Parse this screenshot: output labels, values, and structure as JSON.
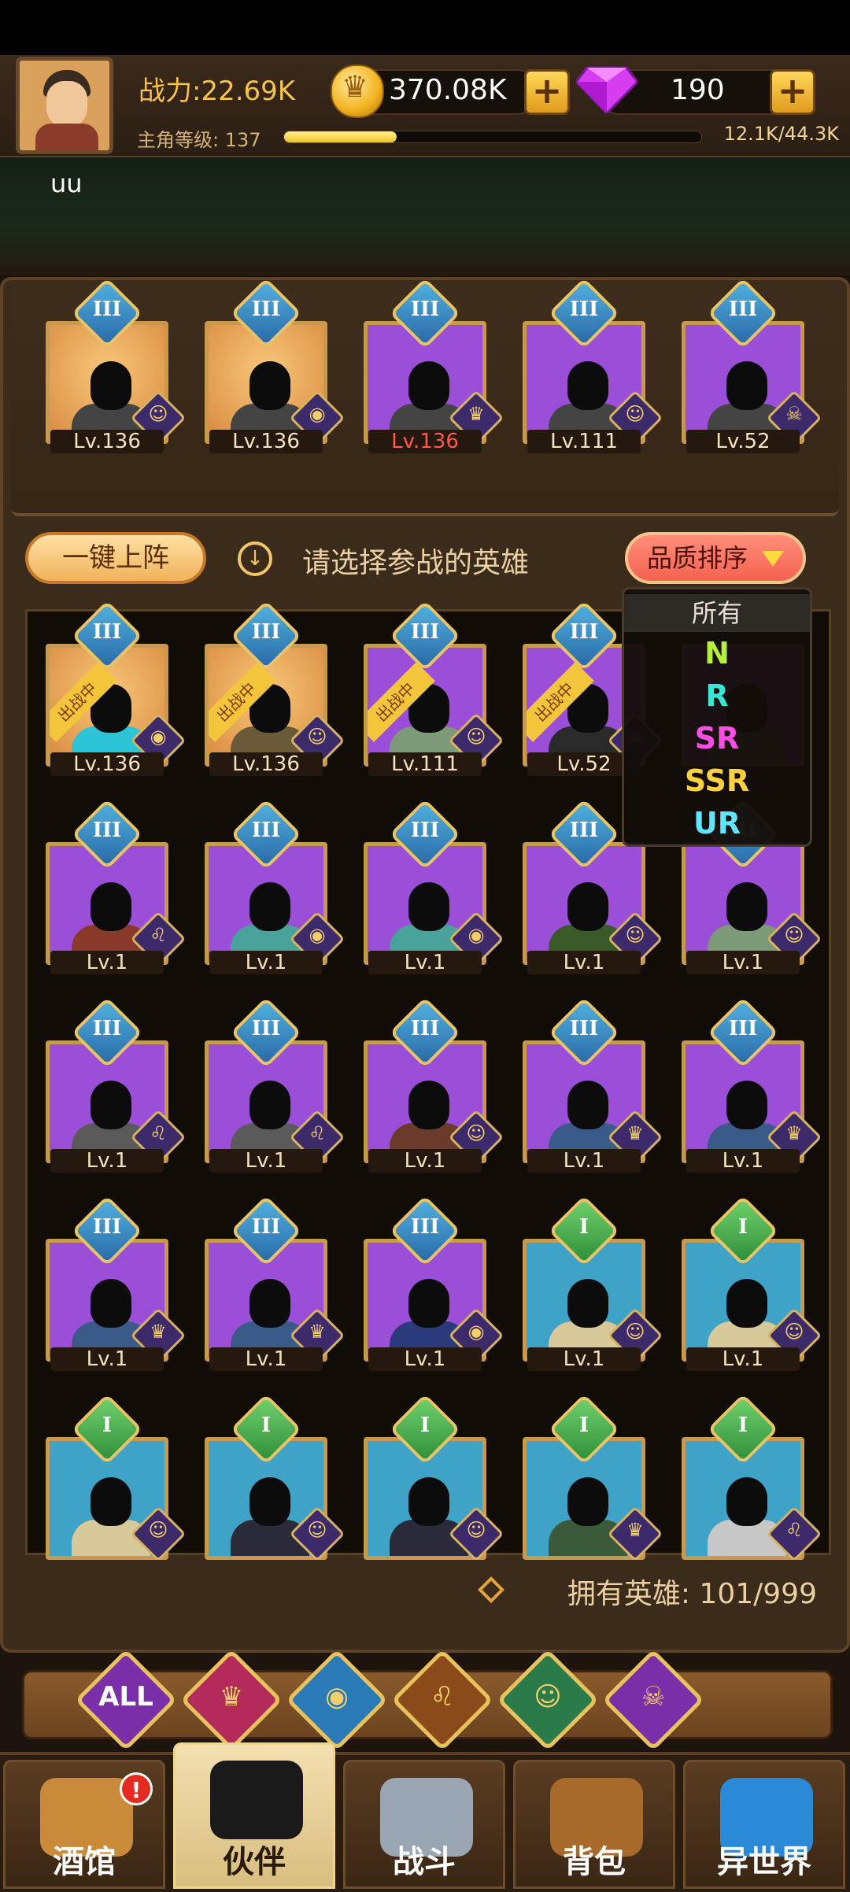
{
  "header": {
    "power_text": "战力:22.69K",
    "level_label": "主角等级: 137",
    "exp_text": "12.1K/44.3K",
    "exp_progress": 0.27,
    "gold": "370.08K",
    "gems": "190",
    "plus": "+",
    "username": "uu"
  },
  "team": [
    {
      "level": "Lv.136",
      "rank": "III",
      "bg": "gold",
      "class_glyph": "☺",
      "red": false
    },
    {
      "level": "Lv.136",
      "rank": "III",
      "bg": "gold",
      "class_glyph": "◉",
      "red": false
    },
    {
      "level": "Lv.136",
      "rank": "III",
      "bg": "purple",
      "class_glyph": "♛",
      "red": true
    },
    {
      "level": "Lv.111",
      "rank": "III",
      "bg": "purple",
      "class_glyph": "☺",
      "red": false
    },
    {
      "level": "Lv.52",
      "rank": "III",
      "bg": "purple",
      "class_glyph": "☠",
      "red": false
    }
  ],
  "actions": {
    "oneclick_label": "一键上阵",
    "hint_text": "请选择参战的英雄",
    "sort_label": "品质排序",
    "info_glyph": "↓"
  },
  "dropdown": {
    "items": [
      {
        "label": "所有",
        "color": "#e8e0d6"
      },
      {
        "label": "N",
        "color": "#b6f03a"
      },
      {
        "label": "R",
        "color": "#37e7d6"
      },
      {
        "label": "SR",
        "color": "#ff4ee8"
      },
      {
        "label": "SSR",
        "color": "#ffd23a"
      },
      {
        "label": "UR",
        "color": "#5fe6ff"
      }
    ]
  },
  "deployed_label": "出战中",
  "heroes": [
    {
      "level": "Lv.136",
      "rank": "III",
      "bg": "gold",
      "deployed": true,
      "class_glyph": "◉",
      "color": "#2ec4d8"
    },
    {
      "level": "Lv.136",
      "rank": "III",
      "bg": "gold",
      "deployed": true,
      "class_glyph": "☺",
      "color": "#6b5a3a"
    },
    {
      "level": "Lv.111",
      "rank": "III",
      "bg": "purple",
      "deployed": true,
      "class_glyph": "☺",
      "color": "#7d9a78"
    },
    {
      "level": "Lv.52",
      "rank": "III",
      "bg": "purple",
      "deployed": true,
      "class_glyph": "☠",
      "color": "#2a2a2a"
    },
    {
      "level": "",
      "rank": "",
      "bg": "purple",
      "deployed": false,
      "class_glyph": "",
      "color": "#7d9a78"
    },
    {
      "level": "Lv.1",
      "rank": "III",
      "bg": "purple",
      "deployed": false,
      "class_glyph": "♌",
      "color": "#8a3a2a"
    },
    {
      "level": "Lv.1",
      "rank": "III",
      "bg": "purple",
      "deployed": false,
      "class_glyph": "◉",
      "color": "#4aa39a"
    },
    {
      "level": "Lv.1",
      "rank": "III",
      "bg": "purple",
      "deployed": false,
      "class_glyph": "◉",
      "color": "#4aa39a"
    },
    {
      "level": "Lv.1",
      "rank": "III",
      "bg": "purple",
      "deployed": false,
      "class_glyph": "☺",
      "color": "#3a5a2a"
    },
    {
      "level": "Lv.1",
      "rank": "III",
      "bg": "purple",
      "deployed": false,
      "class_glyph": "☺",
      "color": "#7d9a78"
    },
    {
      "level": "Lv.1",
      "rank": "III",
      "bg": "purple",
      "deployed": false,
      "class_glyph": "♌",
      "color": "#5a5a5a"
    },
    {
      "level": "Lv.1",
      "rank": "III",
      "bg": "purple",
      "deployed": false,
      "class_glyph": "♌",
      "color": "#5a5a5a"
    },
    {
      "level": "Lv.1",
      "rank": "III",
      "bg": "purple",
      "deployed": false,
      "class_glyph": "☺",
      "color": "#6a3a2a"
    },
    {
      "level": "Lv.1",
      "rank": "III",
      "bg": "purple",
      "deployed": false,
      "class_glyph": "♛",
      "color": "#3a5a8a"
    },
    {
      "level": "Lv.1",
      "rank": "III",
      "bg": "purple",
      "deployed": false,
      "class_glyph": "♛",
      "color": "#3a5a8a"
    },
    {
      "level": "Lv.1",
      "rank": "III",
      "bg": "purple",
      "deployed": false,
      "class_glyph": "♛",
      "color": "#3a5a8a"
    },
    {
      "level": "Lv.1",
      "rank": "III",
      "bg": "purple",
      "deployed": false,
      "class_glyph": "♛",
      "color": "#3a5a8a"
    },
    {
      "level": "Lv.1",
      "rank": "III",
      "bg": "purple",
      "deployed": false,
      "class_glyph": "◉",
      "color": "#2a3a7a"
    },
    {
      "level": "Lv.1",
      "rank": "I",
      "bg": "blue",
      "deployed": false,
      "class_glyph": "☺",
      "color": "#d8c99a"
    },
    {
      "level": "Lv.1",
      "rank": "I",
      "bg": "blue",
      "deployed": false,
      "class_glyph": "☺",
      "color": "#d8c99a"
    },
    {
      "level": "",
      "rank": "I",
      "bg": "blue",
      "deployed": false,
      "class_glyph": "☺",
      "color": "#d8c99a"
    },
    {
      "level": "",
      "rank": "I",
      "bg": "blue",
      "deployed": false,
      "class_glyph": "☺",
      "color": "#2a2a3a"
    },
    {
      "level": "",
      "rank": "I",
      "bg": "blue",
      "deployed": false,
      "class_glyph": "☺",
      "color": "#2a2a3a"
    },
    {
      "level": "",
      "rank": "I",
      "bg": "blue",
      "deployed": false,
      "class_glyph": "♛",
      "color": "#3a5a3a"
    },
    {
      "level": "",
      "rank": "I",
      "bg": "blue",
      "deployed": false,
      "class_glyph": "♌",
      "color": "#c8c8c8"
    }
  ],
  "owned": {
    "text": "拥有英雄: 101/999"
  },
  "filters": [
    {
      "label": "ALL",
      "color": "#7a2fa8"
    },
    {
      "label": "",
      "color": "#b42a5a"
    },
    {
      "label": "",
      "color": "#2a7ab8"
    },
    {
      "label": "",
      "color": "#8a4a1a"
    },
    {
      "label": "",
      "color": "#2a7a4a"
    },
    {
      "label": "",
      "color": "#7a2fa8"
    }
  ],
  "filter_icons": [
    "",
    "♛",
    "◉",
    "♌",
    "☺",
    "☠"
  ],
  "nav": [
    {
      "label": "酒馆",
      "active": false,
      "art": "#c98a3a"
    },
    {
      "label": "伙伴",
      "active": true,
      "art": "#1a1a1a"
    },
    {
      "label": "战斗",
      "active": false,
      "art": "#9aa6b4"
    },
    {
      "label": "背包",
      "active": false,
      "art": "#a86a2a"
    },
    {
      "label": "异世界",
      "active": false,
      "art": "#2a8ad8"
    }
  ],
  "notification": "!"
}
